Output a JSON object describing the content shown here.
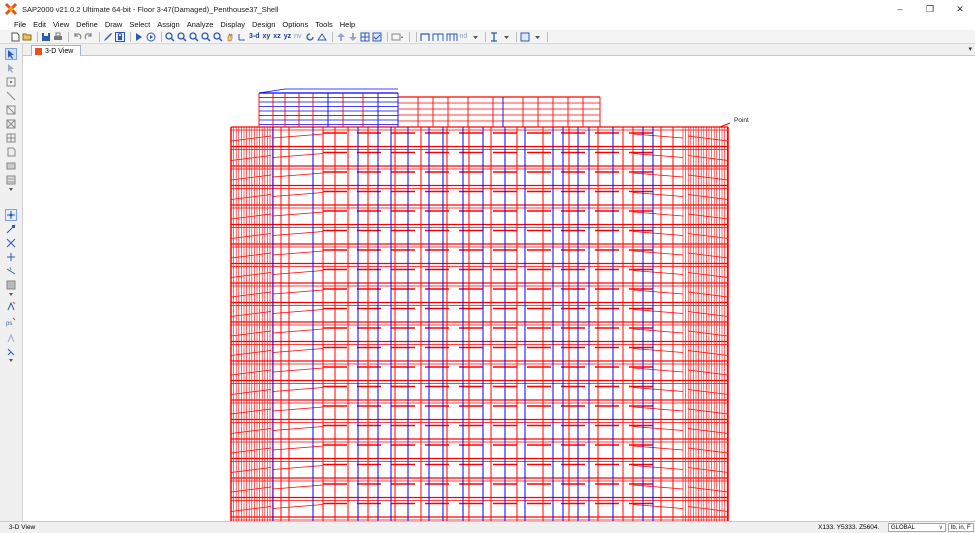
{
  "window": {
    "title": "SAP2000 v21.0.2 Ultimate 64-bit - Floor 3-47(Damaged)_Penthouse37_Shell",
    "minimize": "–",
    "maximize": "❐",
    "close": "✕"
  },
  "menu": [
    "File",
    "Edit",
    "View",
    "Define",
    "Draw",
    "Select",
    "Assign",
    "Analyze",
    "Display",
    "Design",
    "Options",
    "Tools",
    "Help"
  ],
  "toolbar": {
    "view_3d": "3-d",
    "view_xy": "xy",
    "view_xz": "xz",
    "view_yz": "yz",
    "view_nv": "nv",
    "nd_label": "nd"
  },
  "tab": {
    "label": "3-D View"
  },
  "canvas": {
    "point_label": "Point"
  },
  "colors": {
    "frame_red": "#ff0000",
    "frame_blue": "#0000ff",
    "canvas_bg": "#ffffff"
  },
  "status": {
    "view": "3-D View",
    "coords": "X133.  Y5333.  Z5604.",
    "coordinate_system": "GLOBAL",
    "units": "lb, in, F"
  }
}
